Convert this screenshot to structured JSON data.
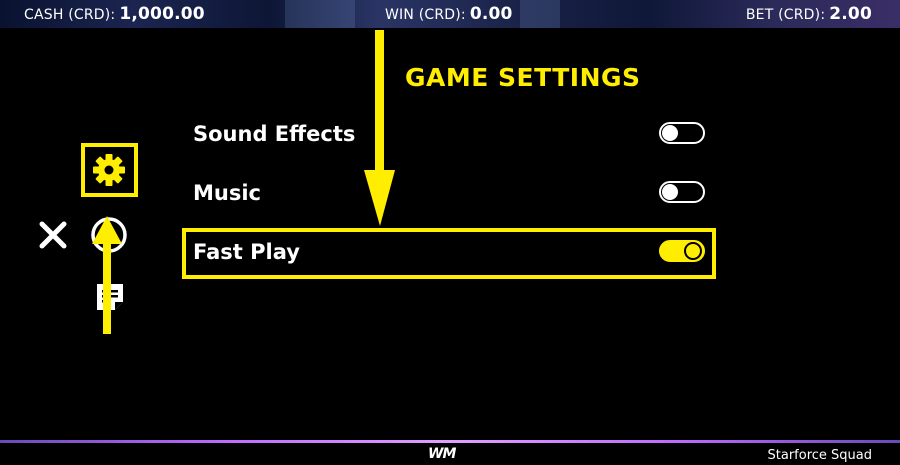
{
  "topbar": {
    "cash_label": "CASH (CRD):",
    "cash_value": "1,000.00",
    "win_label": "WIN (CRD):",
    "win_value": "0.00",
    "bet_label": "BET (CRD):",
    "bet_value": "2.00"
  },
  "settings": {
    "title": "GAME SETTINGS",
    "items": [
      {
        "label": "Sound Effects",
        "enabled": false
      },
      {
        "label": "Music",
        "enabled": false
      },
      {
        "label": "Fast Play",
        "enabled": true
      }
    ]
  },
  "side_menu": {
    "icons": [
      "gear-icon",
      "close-icon",
      "info-icon",
      "paytable-icon"
    ]
  },
  "footer": {
    "logo_text": "WM",
    "game_name": "Starforce Squad"
  },
  "colors": {
    "accent": "#ffee00",
    "background": "#000000",
    "text": "#ffffff"
  }
}
